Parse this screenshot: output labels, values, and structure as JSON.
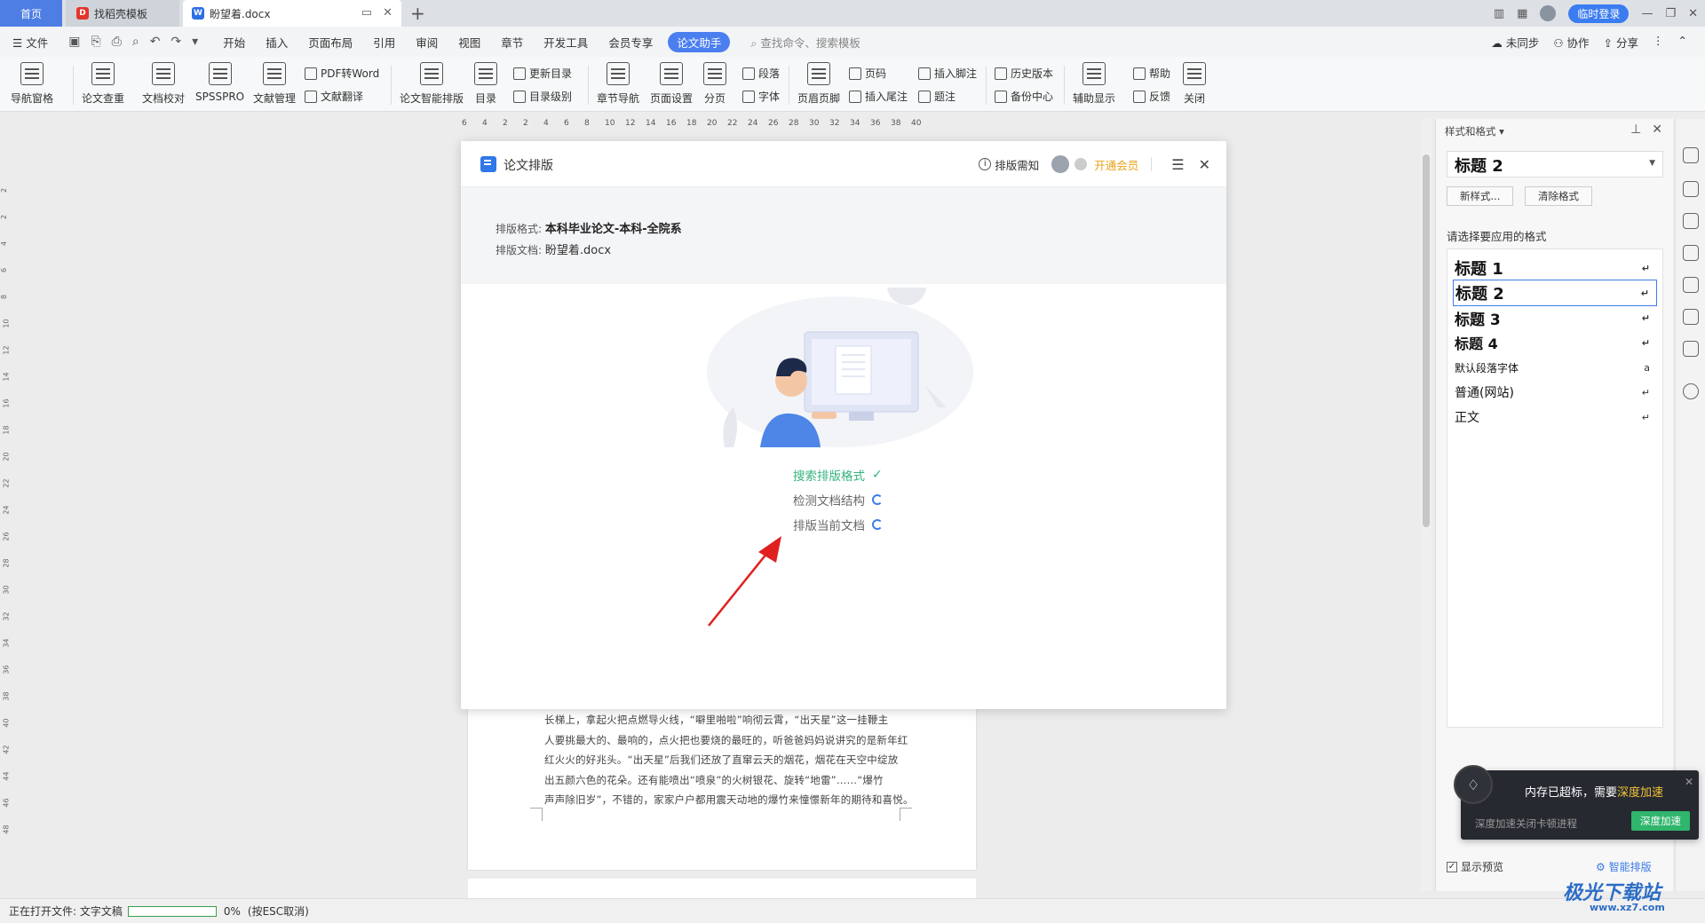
{
  "tabs": {
    "home": "首页",
    "template": "找稻壳模板",
    "doc": "盼望着.docx",
    "login": "临时登录"
  },
  "menu": {
    "items": [
      "开始",
      "插入",
      "页面布局",
      "引用",
      "审阅",
      "视图",
      "章节",
      "开发工具",
      "会员专享"
    ],
    "file": "文件",
    "active": "论文助手",
    "search_placeholder": "查找命令、搜索模板",
    "right": [
      "未同步",
      "协作",
      "分享"
    ]
  },
  "ribbon": {
    "nav_pane": "导航窗格",
    "thesis_check": "论文查重",
    "doc_proof": "文档校对",
    "spsspro": "SPSSPRO",
    "lit_manage": "文献管理",
    "pdf_word": "PDF转Word",
    "lit_translate": "文献翻译",
    "smart_layout": "论文智能排版",
    "toc": "目录",
    "update_toc": "更新目录",
    "toc_level": "目录级别",
    "chapter_nav": "章节导航",
    "page_setup": "页面设置",
    "section_break": "分页",
    "paragraph": "段落",
    "font": "字体",
    "header_footer": "页眉页脚",
    "page_num": "页码",
    "insert_footnote": "插入脚注",
    "insert_endnote": "插入尾注",
    "caption": "题注",
    "history": "历史版本",
    "backup": "备份中心",
    "aux_display": "辅助显示",
    "help": "帮助",
    "feedback": "反馈",
    "close": "关闭"
  },
  "ruler_top": [
    "6",
    "4",
    "2",
    "2",
    "4",
    "6",
    "8",
    "10",
    "12",
    "14",
    "16",
    "18",
    "20",
    "22",
    "24",
    "26",
    "28",
    "30",
    "32",
    "34",
    "36",
    "38",
    "40"
  ],
  "ruler_left": [
    "2",
    "2",
    "4",
    "6",
    "8",
    "10",
    "12",
    "14",
    "16",
    "18",
    "20",
    "22",
    "24",
    "26",
    "28",
    "30",
    "32",
    "34",
    "36",
    "38",
    "40",
    "42",
    "44",
    "46",
    "48"
  ],
  "document": {
    "lines": [
      "长梯上，拿起火把点燃导火线，“噼里啪啦”响彻云霄，“出天星”这一挂鞭主",
      "人要挑最大的、最响的，点火把也要烧的最旺的，听爸爸妈妈说讲究的是新年红",
      "红火火的好兆头。“出天星”后我们还放了直窜云天的烟花，烟花在天空中绽放",
      "出五颜六色的花朵。还有能喷出“喷泉”的火树银花、旋转“地雷”……“爆竹",
      "声声除旧岁”，不错的，家家户户都用震天动地的爆竹来憧憬新年的期待和喜悦。"
    ]
  },
  "modal": {
    "title": "论文排版",
    "notice": "排版需知",
    "vip": "开通会员",
    "format_label": "排版格式:",
    "format_value": "本科毕业论文-本科-全院系",
    "doc_label": "排版文档:",
    "doc_value": "盼望着.docx",
    "steps": [
      {
        "label": "搜索排版格式",
        "status": "done"
      },
      {
        "label": "检测文档结构",
        "status": "loading"
      },
      {
        "label": "排版当前文档",
        "status": "loading"
      }
    ]
  },
  "panel": {
    "header": "样式和格式",
    "current_style": "标题  2",
    "new_style": "新样式...",
    "clear_format": "清除格式",
    "subtitle": "请选择要应用的格式",
    "styles": [
      {
        "label": "标题  1",
        "mark": "↵"
      },
      {
        "label": "标题  2",
        "mark": "↵",
        "selected": true
      },
      {
        "label": "标题  3",
        "mark": "↵"
      },
      {
        "label": "标题  4",
        "mark": "↵"
      },
      {
        "label": "默认段落字体",
        "mark": "a"
      },
      {
        "label": "普通(网站)",
        "mark": "↵"
      },
      {
        "label": "正文",
        "mark": "↵"
      }
    ],
    "show_preview": "显示预览",
    "smart_layout": "智能排版"
  },
  "toast": {
    "text_prefix": "内存已超标，需要",
    "text_highlight": "深度加速",
    "hint": "深度加速关闭卡顿进程",
    "button": "深度加速"
  },
  "status": {
    "opening": "正在打开文件: 文字文稿",
    "percent": "0%",
    "cancel_hint": "(按ESC取消)"
  },
  "watermark": {
    "brand": "极光下载站",
    "url": "www.xz7.com"
  },
  "colors": {
    "accent": "#4b7ff0",
    "success": "#35b37e",
    "vip": "#e8a21a",
    "arrow": "#e02020"
  }
}
